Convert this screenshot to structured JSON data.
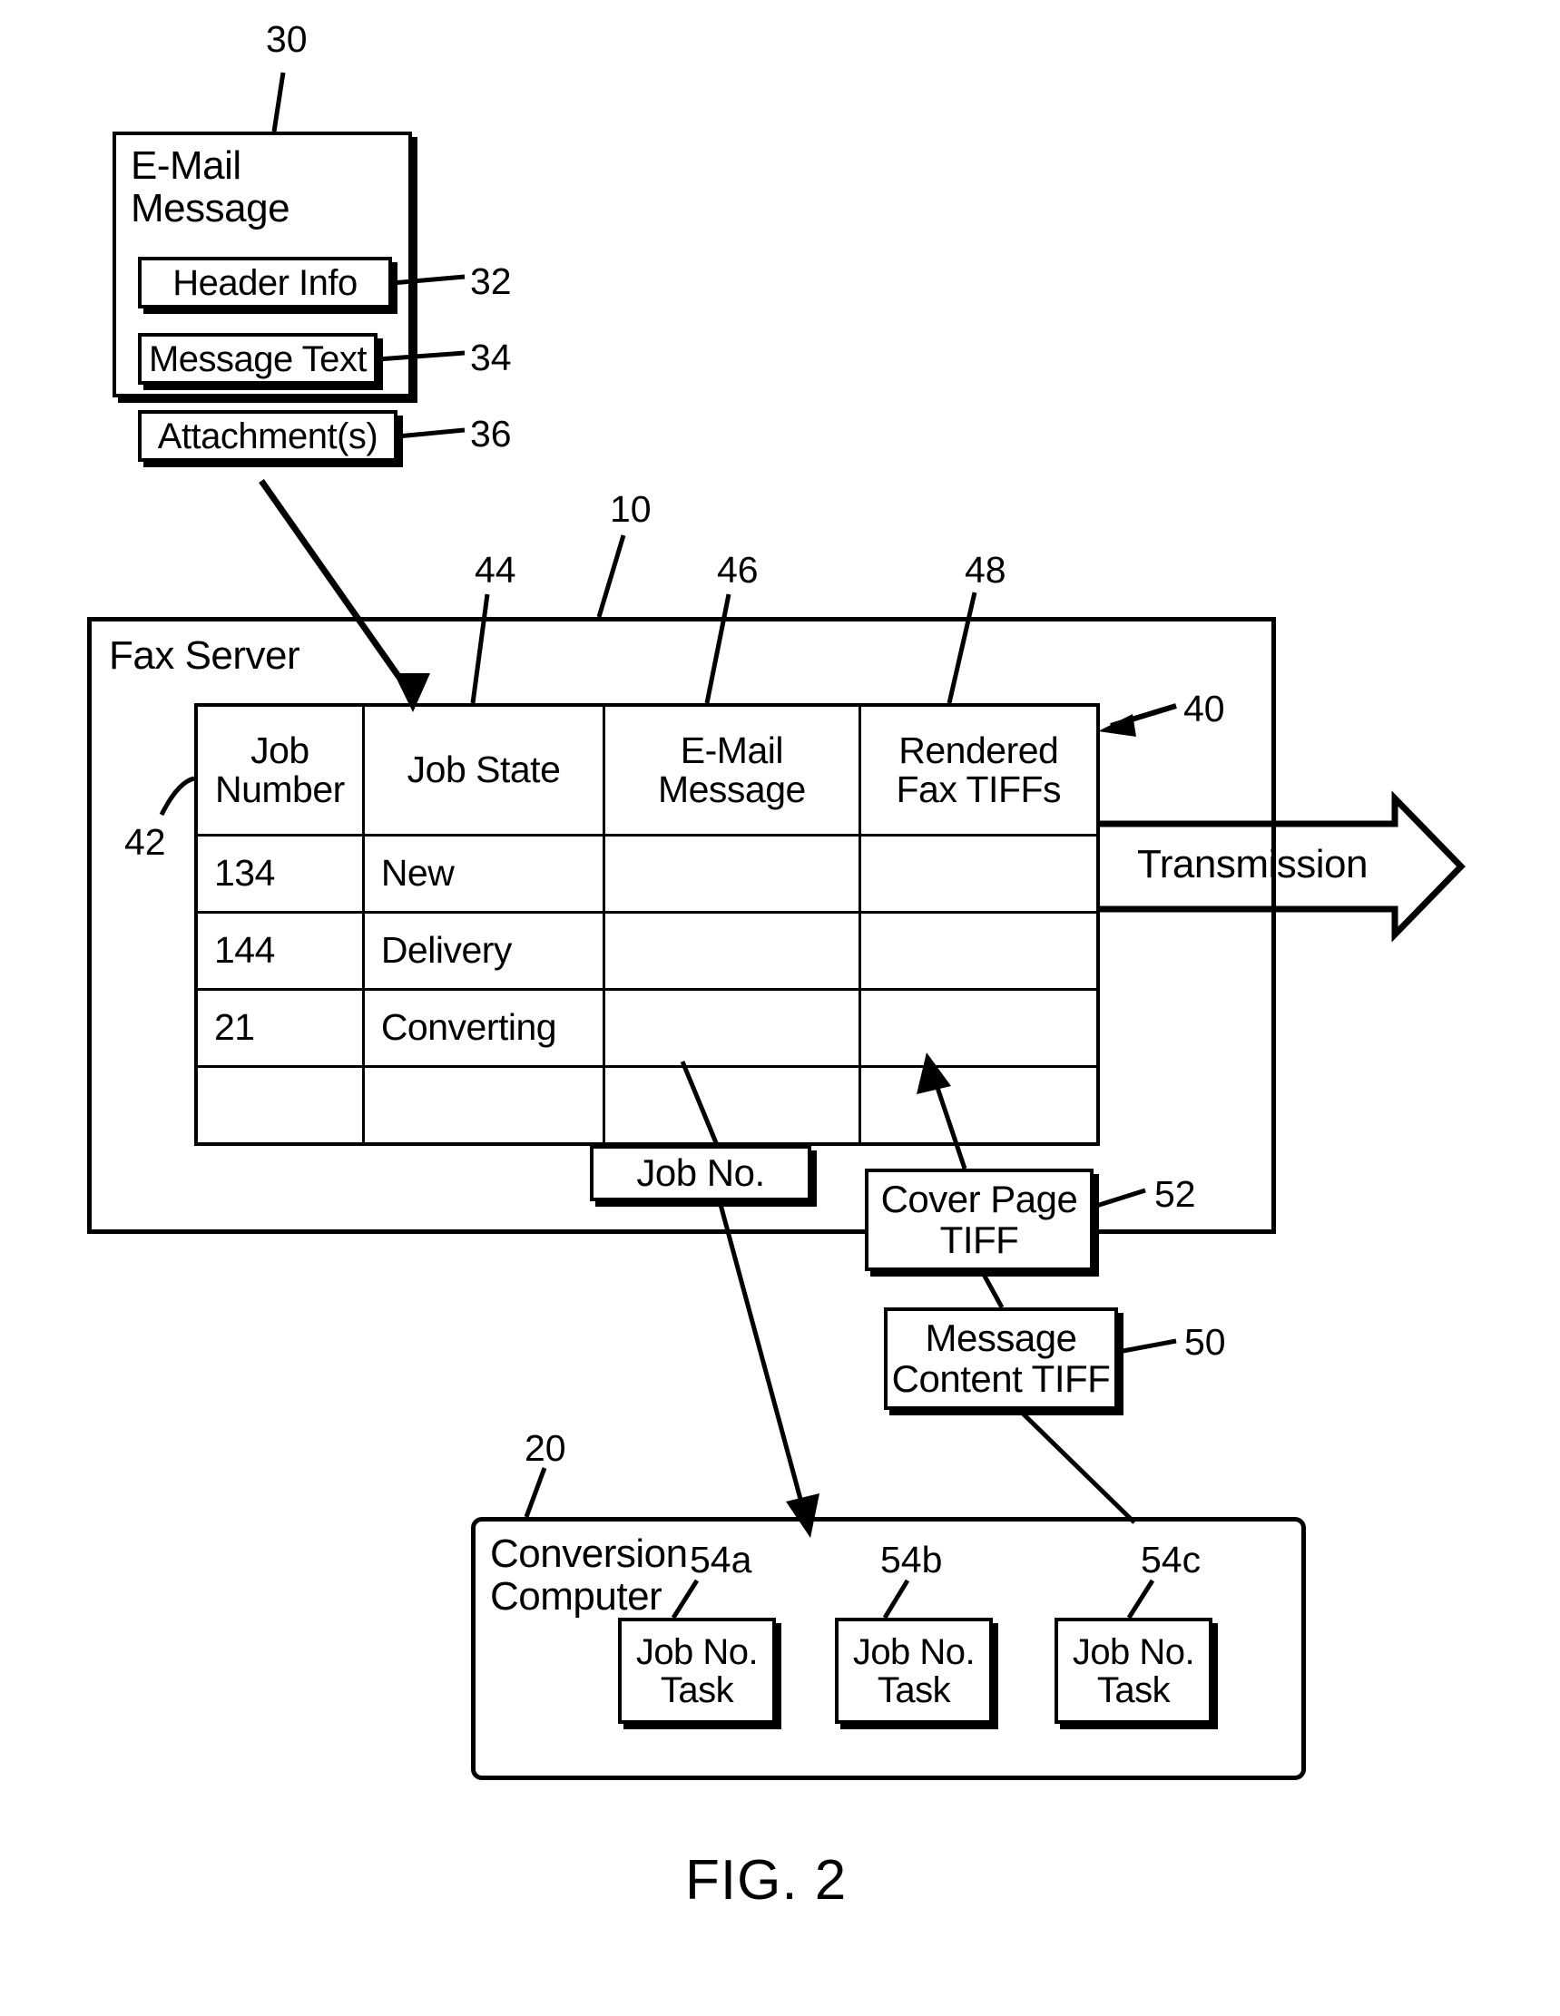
{
  "figure": {
    "caption": "FIG. 2"
  },
  "email_box": {
    "title": "E-Mail\nMessage",
    "ref": "30",
    "items": [
      {
        "label": "Header Info",
        "ref": "32"
      },
      {
        "label": "Message Text",
        "ref": "34"
      },
      {
        "label": "Attachment(s)",
        "ref": "36"
      }
    ]
  },
  "fax_server": {
    "title": "Fax Server",
    "ref": "10",
    "table": {
      "ref": "40",
      "row_ref": "42",
      "column_refs": [
        "44",
        "46",
        "48"
      ],
      "columns": [
        "Job\nNumber",
        "Job State",
        "E-Mail\nMessage",
        "Rendered\nFax TIFFs"
      ],
      "rows": [
        {
          "job_number": "134",
          "job_state": "New",
          "email_message": "",
          "rendered_fax_tiffs": ""
        },
        {
          "job_number": "144",
          "job_state": "Delivery",
          "email_message": "",
          "rendered_fax_tiffs": ""
        },
        {
          "job_number": "21",
          "job_state": "Converting",
          "email_message": "",
          "rendered_fax_tiffs": ""
        },
        {
          "job_number": "",
          "job_state": "",
          "email_message": "",
          "rendered_fax_tiffs": ""
        }
      ]
    },
    "transmission_arrow": {
      "label": "Transmission"
    },
    "job_no_box": {
      "label": "Job No."
    },
    "cover_page_tiff": {
      "label": "Cover Page\nTIFF",
      "ref": "52"
    },
    "message_content_tiff": {
      "label": "Message\nContent TIFF",
      "ref": "50"
    }
  },
  "conversion_computer": {
    "title": "Conversion\nComputer",
    "ref": "20",
    "tasks": [
      {
        "label": "Job No.\nTask",
        "ref": "54a"
      },
      {
        "label": "Job No.\nTask",
        "ref": "54b"
      },
      {
        "label": "Job No.\nTask",
        "ref": "54c"
      }
    ]
  }
}
